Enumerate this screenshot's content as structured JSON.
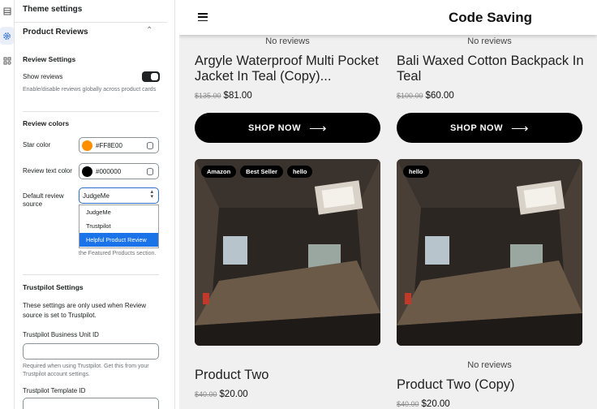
{
  "panel": {
    "theme_title": "Theme settings",
    "section_title": "Product Reviews",
    "review_settings_title": "Review Settings",
    "show_reviews_label": "Show reviews",
    "show_reviews_help": "Enable/disable reviews globally across product cards",
    "show_reviews_enabled": true,
    "review_colors_title": "Review colors",
    "star_color_label": "Star color",
    "star_color_value": "#FF8E00",
    "review_text_color_label": "Review text color",
    "review_text_color_value": "#000000",
    "default_source_label": "Default review source",
    "default_source_value": "JudgeMe",
    "source_options": [
      "JudgeMe",
      "Trustpilot",
      "Helpful Product Review"
    ],
    "source_help_tail": "the Featured Products section.",
    "trustpilot_title": "Trustpilot Settings",
    "trustpilot_desc": "These settings are only used when Review source is set to Trustpilot.",
    "business_unit_label": "Trustpilot Business Unit ID",
    "business_unit_value": "",
    "business_unit_help": "Required when using Trustpilot. Get this from your Trustpilot account settings.",
    "template_id_label": "Trustpilot Template ID",
    "template_id_value": ""
  },
  "store": {
    "title": "Code Saving",
    "no_reviews": "No reviews",
    "shop_now": "SHOP NOW",
    "products": [
      {
        "name": "Argyle Waterproof Multi Pocket Jacket In Teal (Copy)...",
        "old_price": "$135.00",
        "price": "$81.00"
      },
      {
        "name": "Bali Waxed Cotton Backpack In Teal",
        "old_price": "$100.00",
        "price": "$60.00"
      },
      {
        "name": "Product Two",
        "old_price": "$40.00",
        "price": "$20.00",
        "badges": [
          "Amazon",
          "Best Seller",
          "hello"
        ]
      },
      {
        "name": "Product Two (Copy)",
        "old_price": "$40.00",
        "price": "$20.00",
        "badges": [
          "hello"
        ]
      }
    ]
  },
  "colors": {
    "star": "#FF8E00",
    "text": "#000000",
    "accent": "#2C6ECB",
    "dropdown_selected": "#1A73E8"
  }
}
